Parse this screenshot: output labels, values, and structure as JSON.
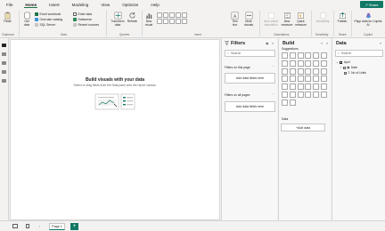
{
  "menu": {
    "items": [
      "File",
      "Home",
      "Insert",
      "Modeling",
      "View",
      "Optimize",
      "Help"
    ],
    "active": "Home",
    "share_label": "Share"
  },
  "ribbon": {
    "paste_label": "Paste",
    "get_data_label": "Get data",
    "excel_label": "Excel workbook",
    "onelake_label": "OneLake catalog",
    "sqlserver_label": "SQL Server",
    "enter_data_label": "Enter data",
    "dataverse_label": "Dataverse",
    "recent_label": "Recent sources",
    "transform_label": "Transform data",
    "refresh_label": "Refresh",
    "new_visual_label": "New visual",
    "text_box_label": "Text box",
    "more_visuals_label": "More visuals",
    "new_measure_label": "New visual calculation",
    "new_measure2_label": "New measure",
    "quick_measure_label": "Quick measure",
    "sensitivity_label": "Sensitivity",
    "publish_label": "Publish",
    "copilot_label": "Pbpp data for Copilot AI",
    "groups": {
      "clipboard": "Clipboard",
      "data": "Data",
      "queries": "Queries",
      "insert": "Insert",
      "calculations": "Calculations",
      "sensitivity": "Sensitivity",
      "share": "Share",
      "copilot": "Copilot"
    }
  },
  "canvas": {
    "title": "Build visuals with your data",
    "subtitle": "Select or drag fields from the Data pane onto the report canvas."
  },
  "filters": {
    "title": "Filters",
    "search_placeholder": "Search",
    "on_page_label": "Filters on this page",
    "on_page_drop": "Add data fields here",
    "all_pages_label": "Filters on all pages",
    "all_pages_drop": "Add data fields here"
  },
  "build": {
    "title": "Build",
    "suggestions_label": "Suggestions",
    "data_label": "Data",
    "add_data_label": "+Add data"
  },
  "data_pane": {
    "title": "Data",
    "search_placeholder": "Search",
    "table_name": "April",
    "fields": [
      "Date",
      "No of Units"
    ]
  },
  "bottom": {
    "page_tab": "Page 1",
    "add_page": "+"
  },
  "colors": {
    "accent": "#117865",
    "ribbon_bg": "#f3f2f1",
    "canvas_bg": "#ffffff"
  }
}
